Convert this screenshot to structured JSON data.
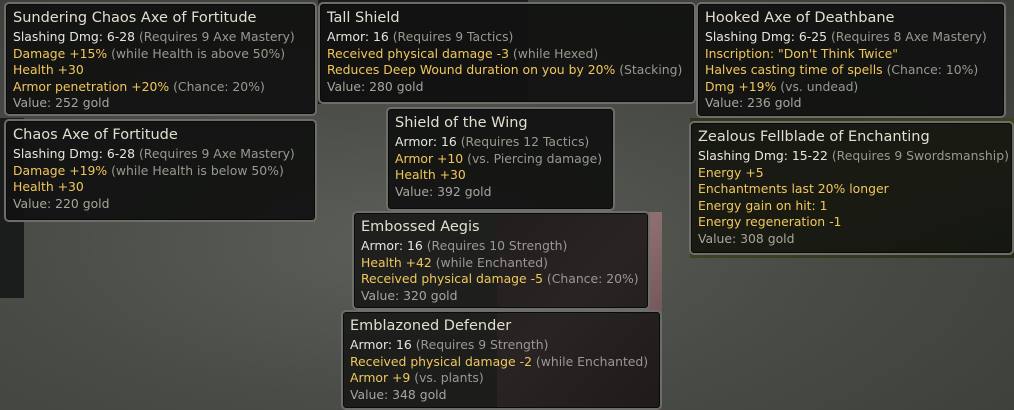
{
  "tooltips": [
    {
      "title": "Sundering Chaos Axe of Fortitude",
      "lines": [
        [
          {
            "t": "Slashing Dmg: 6-28 ",
            "c": "w"
          },
          {
            "t": "(Requires 9 Axe Mastery)",
            "c": "g"
          }
        ],
        [
          {
            "t": "Damage +15% ",
            "c": "y"
          },
          {
            "t": "(while Health is above 50%)",
            "c": "g"
          }
        ],
        [
          {
            "t": "Health +30",
            "c": "y"
          }
        ],
        [
          {
            "t": "Armor penetration +20% ",
            "c": "y"
          },
          {
            "t": "(Chance: 20%)",
            "c": "g"
          }
        ]
      ],
      "value": "Value: 252 gold"
    },
    {
      "title": "Chaos Axe of Fortitude",
      "lines": [
        [
          {
            "t": "Slashing Dmg: 6-28 ",
            "c": "w"
          },
          {
            "t": "(Requires 9 Axe Mastery)",
            "c": "g"
          }
        ],
        [
          {
            "t": "Damage +19% ",
            "c": "y"
          },
          {
            "t": "(while Health is below 50%)",
            "c": "g"
          }
        ],
        [
          {
            "t": "Health +30",
            "c": "y"
          }
        ]
      ],
      "value": "Value: 220 gold"
    },
    {
      "title": "Tall Shield",
      "lines": [
        [
          {
            "t": "Armor: 16 ",
            "c": "w"
          },
          {
            "t": "(Requires 9 Tactics)",
            "c": "g"
          }
        ],
        [
          {
            "t": "Received physical damage -3 ",
            "c": "y"
          },
          {
            "t": "(while Hexed)",
            "c": "g"
          }
        ],
        [
          {
            "t": "Reduces Deep Wound duration on you by 20% ",
            "c": "y"
          },
          {
            "t": "(Stacking)",
            "c": "g"
          }
        ]
      ],
      "value": "Value: 280 gold"
    },
    {
      "title": "Shield of the Wing",
      "lines": [
        [
          {
            "t": "Armor: 16 ",
            "c": "w"
          },
          {
            "t": "(Requires 12 Tactics)",
            "c": "g"
          }
        ],
        [
          {
            "t": "Armor +10 ",
            "c": "y"
          },
          {
            "t": "(vs. Piercing damage)",
            "c": "g"
          }
        ],
        [
          {
            "t": "Health +30",
            "c": "y"
          }
        ]
      ],
      "value": "Value: 392 gold"
    },
    {
      "title": "Embossed Aegis",
      "lines": [
        [
          {
            "t": "Armor: 16 ",
            "c": "w"
          },
          {
            "t": "(Requires 10 Strength)",
            "c": "g"
          }
        ],
        [
          {
            "t": "Health +42 ",
            "c": "y"
          },
          {
            "t": "(while Enchanted)",
            "c": "g"
          }
        ],
        [
          {
            "t": "Received physical damage -5 ",
            "c": "y"
          },
          {
            "t": "(Chance: 20%)",
            "c": "g"
          }
        ]
      ],
      "value": "Value: 320 gold"
    },
    {
      "title": "Emblazoned Defender",
      "lines": [
        [
          {
            "t": "Armor: 16 ",
            "c": "w"
          },
          {
            "t": "(Requires 9 Strength)",
            "c": "g"
          }
        ],
        [
          {
            "t": "Received physical damage -2 ",
            "c": "y"
          },
          {
            "t": "(while Enchanted)",
            "c": "g"
          }
        ],
        [
          {
            "t": "Armor +9 ",
            "c": "y"
          },
          {
            "t": "(vs. plants)",
            "c": "g"
          }
        ]
      ],
      "value": "Value: 348 gold"
    },
    {
      "title": "Hooked Axe of Deathbane",
      "lines": [
        [
          {
            "t": "Slashing Dmg: 6-25 ",
            "c": "w"
          },
          {
            "t": "(Requires 8 Axe Mastery)",
            "c": "g"
          }
        ],
        [
          {
            "t": "Inscription: \"Don't Think Twice\"",
            "c": "y"
          }
        ],
        [
          {
            "t": "Halves casting time of spells ",
            "c": "y"
          },
          {
            "t": "(Chance: 10%)",
            "c": "g"
          }
        ],
        [
          {
            "t": "Dmg +19% ",
            "c": "y"
          },
          {
            "t": "(vs. undead)",
            "c": "g"
          }
        ]
      ],
      "value": "Value: 236 gold"
    },
    {
      "title": "Zealous Fellblade of Enchanting",
      "lines": [
        [
          {
            "t": "Slashing Dmg: 15-22 ",
            "c": "w"
          },
          {
            "t": "(Requires 9 Swordsmanship)",
            "c": "g"
          }
        ],
        [
          {
            "t": "Energy +5",
            "c": "y"
          }
        ],
        [
          {
            "t": "Enchantments last 20% longer",
            "c": "y"
          }
        ],
        [
          {
            "t": "Energy gain on hit: 1",
            "c": "y"
          }
        ],
        [
          {
            "t": "Energy regeneration -1",
            "c": "y"
          }
        ]
      ],
      "value": "Value: 308 gold"
    }
  ]
}
